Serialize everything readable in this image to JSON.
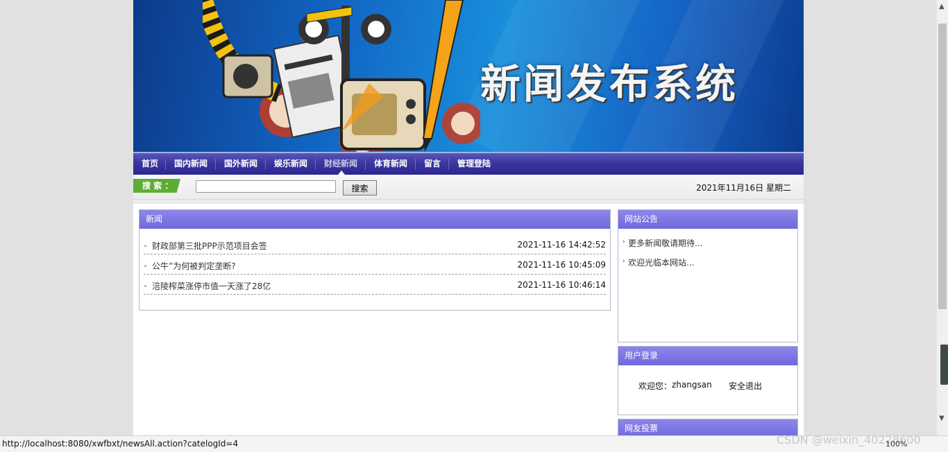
{
  "banner": {
    "title": "新闻发布系统"
  },
  "nav": {
    "items": [
      {
        "label": "首页"
      },
      {
        "label": "国内新闻"
      },
      {
        "label": "国外新闻"
      },
      {
        "label": "娱乐新闻"
      },
      {
        "label": "财经新闻"
      },
      {
        "label": "体育新闻"
      },
      {
        "label": "留言"
      },
      {
        "label": "管理登陆"
      }
    ]
  },
  "search": {
    "label": "搜 索 ：",
    "value": "",
    "button": "搜索"
  },
  "date": "2021年11月16日 星期二",
  "news_panel": {
    "title": "新闻",
    "items": [
      {
        "title": "财政部第三批PPP示范项目会签",
        "time": "2021-11-16 14:42:52"
      },
      {
        "title": "公牛”为何被判定垄断?",
        "time": "2021-11-16 10:45:09"
      },
      {
        "title": "涪陵榨菜涨停市值一天涨了28亿",
        "time": "2021-11-16 10:46:14"
      }
    ]
  },
  "notice_panel": {
    "title": "网站公告",
    "items": [
      {
        "label": "更多新闻敬请期待..."
      },
      {
        "label": "欢迎光临本网站..."
      }
    ]
  },
  "login_panel": {
    "title": "用户登录",
    "welcome": "欢迎您：",
    "username": "zhangsan",
    "logout": "安全退出"
  },
  "vote_panel": {
    "title": "网友投票"
  },
  "statusbar": {
    "url": "http://localhost:8080/xwfbxt/newsAll.action?catelogId=4",
    "watermark": "CSDN @weixin_40228600",
    "zoom": "100%"
  },
  "colors": {
    "nav": "#3a36a0",
    "panel_header": "#7a74e2",
    "search_label": "#5cad34"
  }
}
